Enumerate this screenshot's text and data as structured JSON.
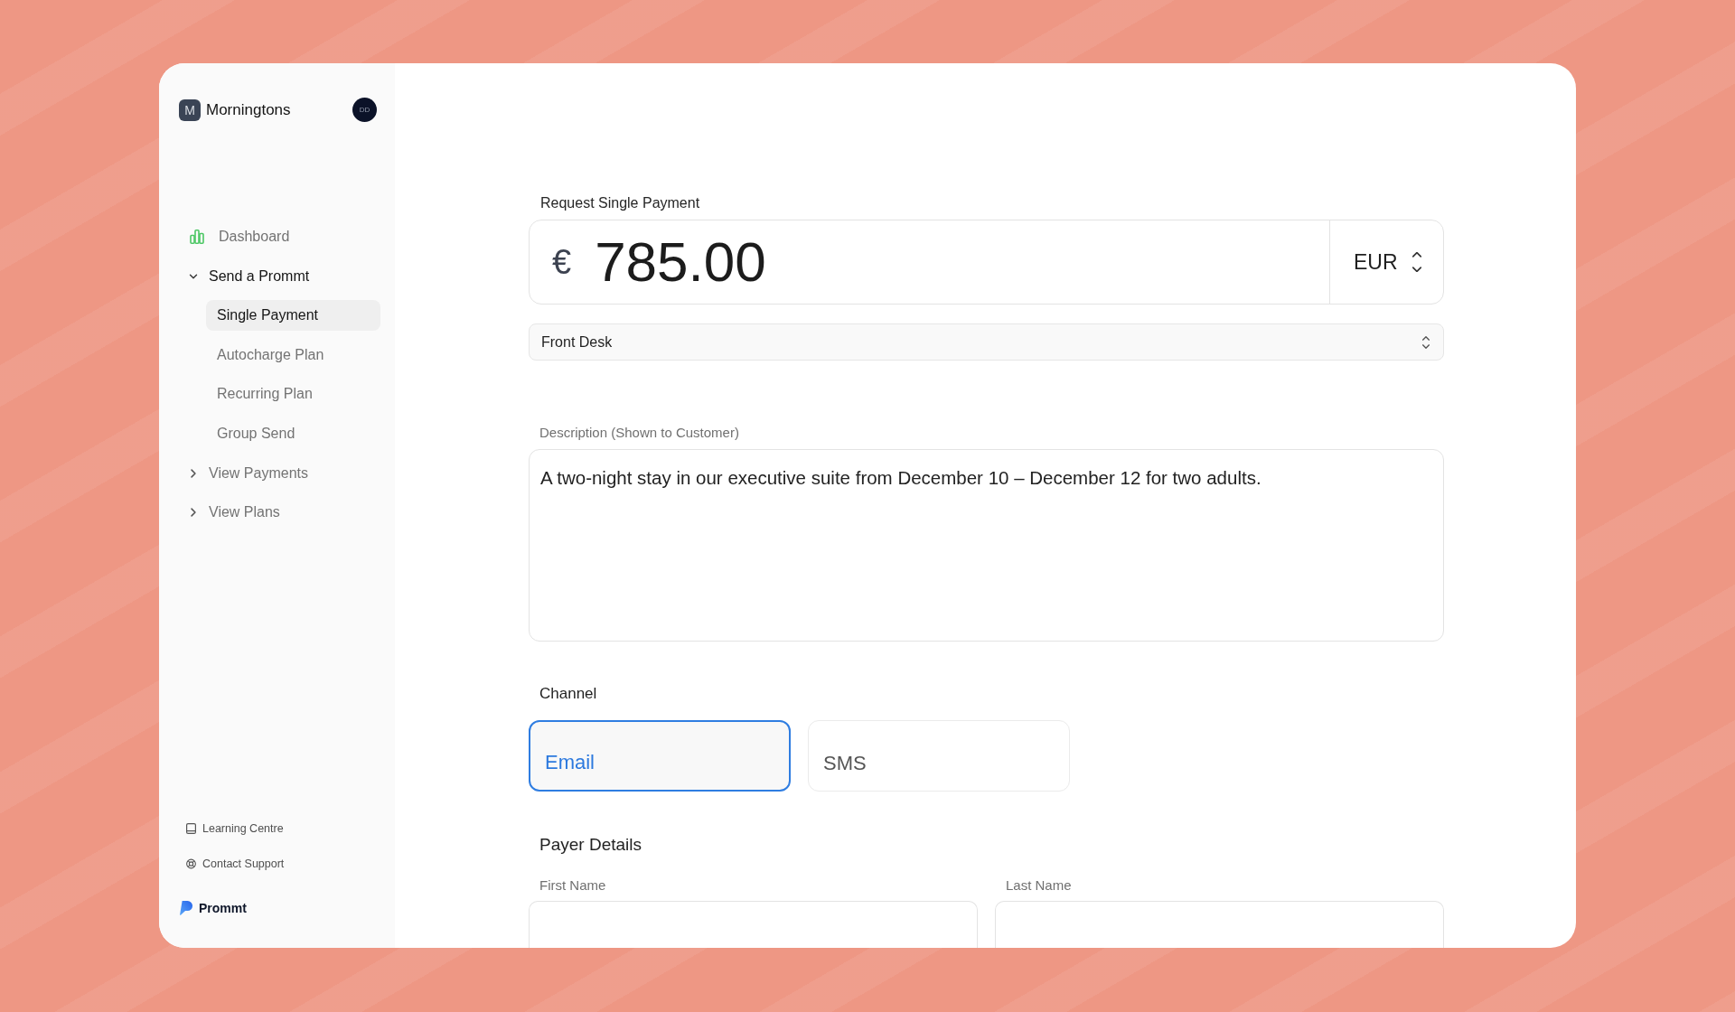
{
  "sidebar": {
    "workspace": {
      "initial": "M",
      "name": "Morningtons"
    },
    "user_avatar": {
      "initials": "DD"
    },
    "nav": [
      {
        "label": "Dashboard",
        "kind": "link",
        "selected": false
      },
      {
        "label": "Send a Prommt",
        "kind": "group",
        "expanded": true,
        "children": [
          {
            "label": "Single Payment",
            "selected": true
          },
          {
            "label": "Autocharge Plan",
            "selected": false
          },
          {
            "label": "Recurring Plan",
            "selected": false
          },
          {
            "label": "Group Send",
            "selected": false
          }
        ]
      },
      {
        "label": "View Payments",
        "kind": "group",
        "expanded": false
      },
      {
        "label": "View Plans",
        "kind": "group",
        "expanded": false
      }
    ],
    "footer_links": [
      {
        "label": "Learning Centre"
      },
      {
        "label": "Contact Support"
      }
    ],
    "brand": {
      "name": "Prommt"
    }
  },
  "form": {
    "title": "Request Single Payment",
    "amount": {
      "currency_symbol": "€",
      "value": "785.00",
      "currency": "EUR"
    },
    "location": {
      "value": "Front Desk"
    },
    "description": {
      "label": "Description (Shown to Customer)",
      "value": "A two-night stay in our executive suite from December 10 – December 12 for two adults."
    },
    "channel": {
      "label": "Channel",
      "options": [
        {
          "label": "Email",
          "selected": true
        },
        {
          "label": "SMS",
          "selected": false
        }
      ]
    },
    "payer": {
      "title": "Payer Details",
      "fields": [
        {
          "label": "First Name"
        },
        {
          "label": "Last Name"
        }
      ]
    }
  }
}
